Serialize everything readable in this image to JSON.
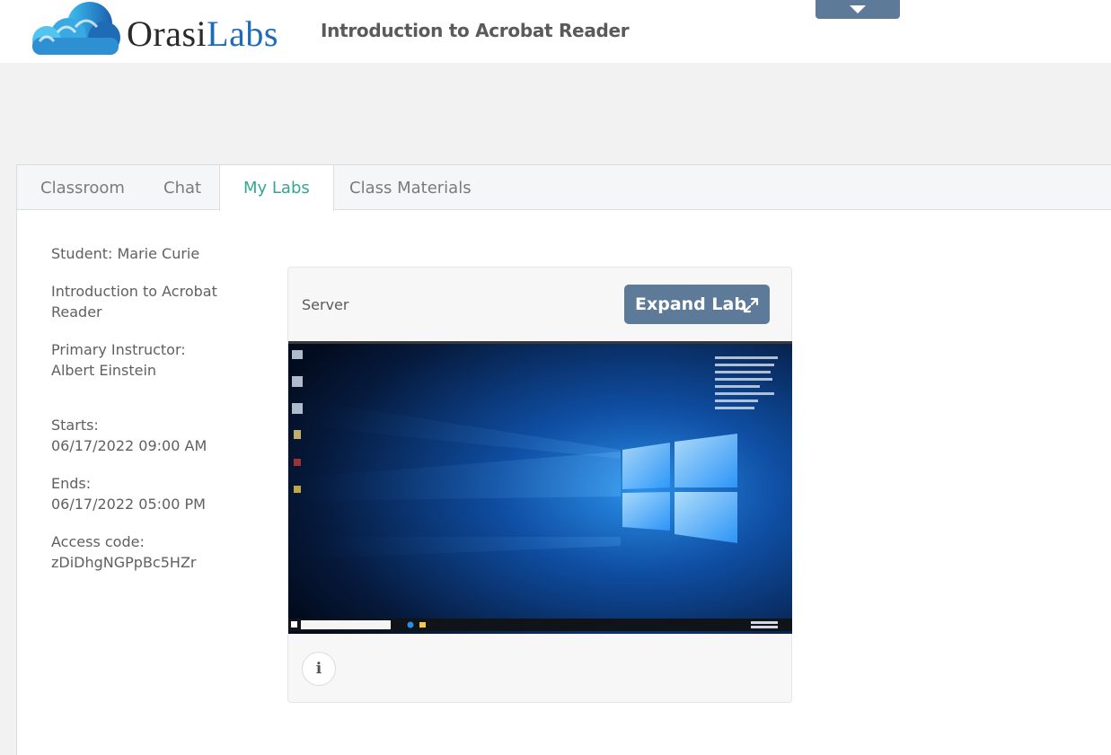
{
  "header": {
    "logo_part1": "Orasi",
    "logo_part2": "Labs",
    "course_title": "Introduction to Acrobat Reader"
  },
  "tabs": [
    {
      "label": "Classroom",
      "active": false
    },
    {
      "label": "Chat",
      "active": false
    },
    {
      "label": "My Labs",
      "active": true
    },
    {
      "label": "Class Materials",
      "active": false
    }
  ],
  "info": {
    "student": "Student: Marie Curie",
    "course": "Introduction to Acrobat Reader",
    "instructor_label": "Primary Instructor:",
    "instructor_name": "Albert Einstein",
    "starts_label": "Starts:",
    "starts_value": "06/17/2022 09:00 AM",
    "ends_label": "Ends:",
    "ends_value": "06/17/2022 05:00 PM",
    "access_label": "Access code:",
    "access_value": "zDiDhgNGPpBc5HZr"
  },
  "lab": {
    "server_label": "Server",
    "expand_label": "Expand Lab",
    "info_icon_glyph": "i"
  },
  "colors": {
    "accent_tab": "#35a693",
    "button": "#5d7a99",
    "logo_blue": "#1f6bb6"
  },
  "icons": [
    "cloud-logo-icon",
    "chevron-down-icon",
    "expand-icon",
    "info-icon"
  ]
}
